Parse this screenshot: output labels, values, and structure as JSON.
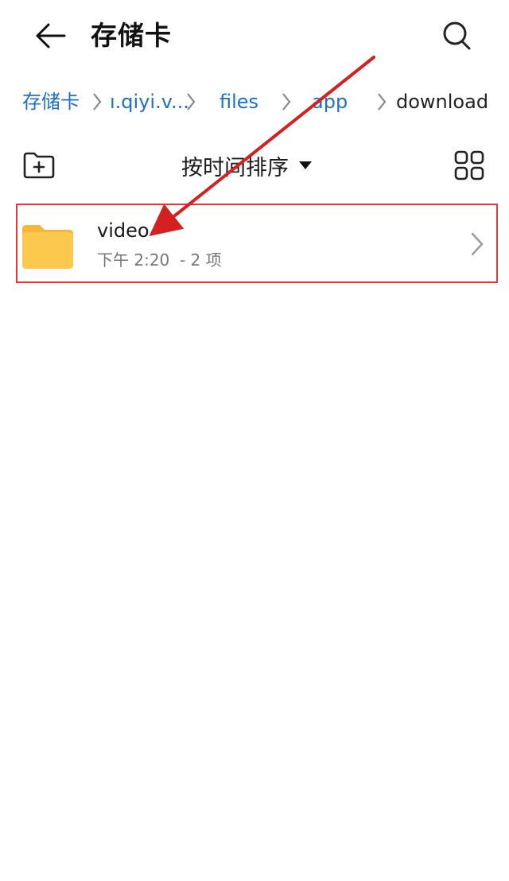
{
  "header": {
    "title": "存储卡",
    "back_icon": "back-arrow-icon",
    "search_icon": "search-icon"
  },
  "breadcrumb": {
    "items": [
      "存储卡",
      "ı.qiyi.v...",
      "files",
      "app",
      "download"
    ],
    "link_color": "#1e6fc7"
  },
  "toolbar": {
    "new_folder_icon": "new-folder-icon",
    "sort_label": "按时间排序",
    "sort_icon": "caret-down-icon",
    "view_icon": "grid-view-icon"
  },
  "files": [
    {
      "name": "video",
      "meta": "下午 2:20  - 2 项",
      "icon": "folder-icon",
      "folder_color": "#fcc84e"
    }
  ],
  "annotation": {
    "color": "#d42020",
    "highlight": "red box around video folder row with arrow pointing to it"
  }
}
